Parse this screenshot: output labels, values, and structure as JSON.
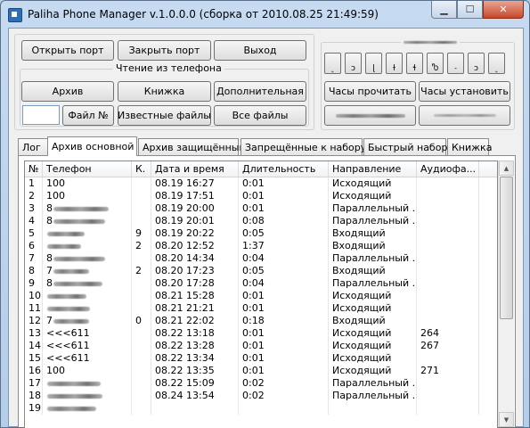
{
  "window": {
    "title": "Paliha Phone Manager v.1.0.0.0 (сборка от 2010.08.25 21:49:59)",
    "caption_buttons": {
      "minimize": "▁",
      "maximize": "☐",
      "close": "✕"
    }
  },
  "toolbar": {
    "open_port": "Открыть порт",
    "close_port": "Закрыть порт",
    "exit": "Выход"
  },
  "read_group": {
    "label": "Чтение из телефона",
    "archive": "Архив",
    "book": "Книжка",
    "additional": "Дополнительная",
    "file_no": "Файл №",
    "file_no_value": "",
    "known_files": "Известные файлы",
    "all_files": "Все файлы"
  },
  "clock_group": {
    "small_buttons": [
      "˻",
      "ɔ",
      "ɭ",
      "ɫ",
      "ɬ",
      "Ⴊ",
      "˗",
      "ɔ",
      "˻"
    ],
    "read_clock": "Часы прочитать",
    "set_clock": "Часы установить"
  },
  "tabs": [
    {
      "label": "Лог",
      "active": false
    },
    {
      "label": "Архив основной",
      "active": true
    },
    {
      "label": "Архив защищённый",
      "active": false
    },
    {
      "label": "Запрещённые к набору",
      "active": false
    },
    {
      "label": "Быстрый набор",
      "active": false
    },
    {
      "label": "Книжка",
      "active": false
    }
  ],
  "table": {
    "columns": [
      "№",
      "Телефон",
      "К.",
      "Дата и время",
      "Длительность",
      "Направление",
      "Аудиофа..."
    ],
    "rows": [
      {
        "n": "1",
        "phone": "100",
        "k": "",
        "dt": "08.19 16:27",
        "dur": "0:01",
        "dir": "Исходящий",
        "audio": ""
      },
      {
        "n": "2",
        "phone": "100",
        "k": "",
        "dt": "08.19 17:51",
        "dur": "0:01",
        "dir": "Исходящий",
        "audio": ""
      },
      {
        "n": "3",
        "phone": "8",
        "k": "",
        "dt": "08.19 20:00",
        "dur": "0:01",
        "dir": "Параллельный ...",
        "audio": ""
      },
      {
        "n": "4",
        "phone": "8",
        "k": "",
        "dt": "08.19 20:01",
        "dur": "0:08",
        "dir": "Параллельный ...",
        "audio": ""
      },
      {
        "n": "5",
        "phone": "",
        "k": "9",
        "dt": "08.19 20:22",
        "dur": "0:05",
        "dir": "Входящий",
        "audio": ""
      },
      {
        "n": "6",
        "phone": "",
        "k": "2",
        "dt": "08.20 12:52",
        "dur": "1:37",
        "dir": "Входящий",
        "audio": ""
      },
      {
        "n": "7",
        "phone": "8",
        "k": "",
        "dt": "08.20 14:34",
        "dur": "0:04",
        "dir": "Параллельный ...",
        "audio": ""
      },
      {
        "n": "8",
        "phone": "7",
        "k": "2",
        "dt": "08.20 17:23",
        "dur": "0:05",
        "dir": "Входящий",
        "audio": ""
      },
      {
        "n": "9",
        "phone": "8",
        "k": "",
        "dt": "08.20 17:28",
        "dur": "0:04",
        "dir": "Параллельный ...",
        "audio": ""
      },
      {
        "n": "10",
        "phone": "",
        "k": "",
        "dt": "08.21 15:28",
        "dur": "0:01",
        "dir": "Исходящий",
        "audio": ""
      },
      {
        "n": "11",
        "phone": "",
        "k": "",
        "dt": "08.21 21:21",
        "dur": "0:01",
        "dir": "Исходящий",
        "audio": ""
      },
      {
        "n": "12",
        "phone": "7",
        "k": "0",
        "dt": "08.21 22:02",
        "dur": "0:18",
        "dir": "Входящий",
        "audio": ""
      },
      {
        "n": "13",
        "phone": "<<<611",
        "k": "",
        "dt": "08.22 13:18",
        "dur": "0:01",
        "dir": "Исходящий",
        "audio": "264"
      },
      {
        "n": "14",
        "phone": "<<<611",
        "k": "",
        "dt": "08.22 13:28",
        "dur": "0:01",
        "dir": "Исходящий",
        "audio": "267"
      },
      {
        "n": "15",
        "phone": "<<<611",
        "k": "",
        "dt": "08.22 13:34",
        "dur": "0:01",
        "dir": "Исходящий",
        "audio": ""
      },
      {
        "n": "16",
        "phone": "100",
        "k": "",
        "dt": "08.22 13:35",
        "dur": "0:01",
        "dir": "Исходящий",
        "audio": "271"
      },
      {
        "n": "17",
        "phone": "",
        "k": "",
        "dt": "08.22 15:09",
        "dur": "0:02",
        "dir": "Параллельный ...",
        "audio": ""
      },
      {
        "n": "18",
        "phone": "",
        "k": "",
        "dt": "08.24 13:54",
        "dur": "0:02",
        "dir": "Параллельный ...",
        "audio": ""
      },
      {
        "n": "19",
        "phone": "",
        "k": "",
        "dt": "",
        "dur": "",
        "dir": "",
        "audio": ""
      }
    ]
  }
}
